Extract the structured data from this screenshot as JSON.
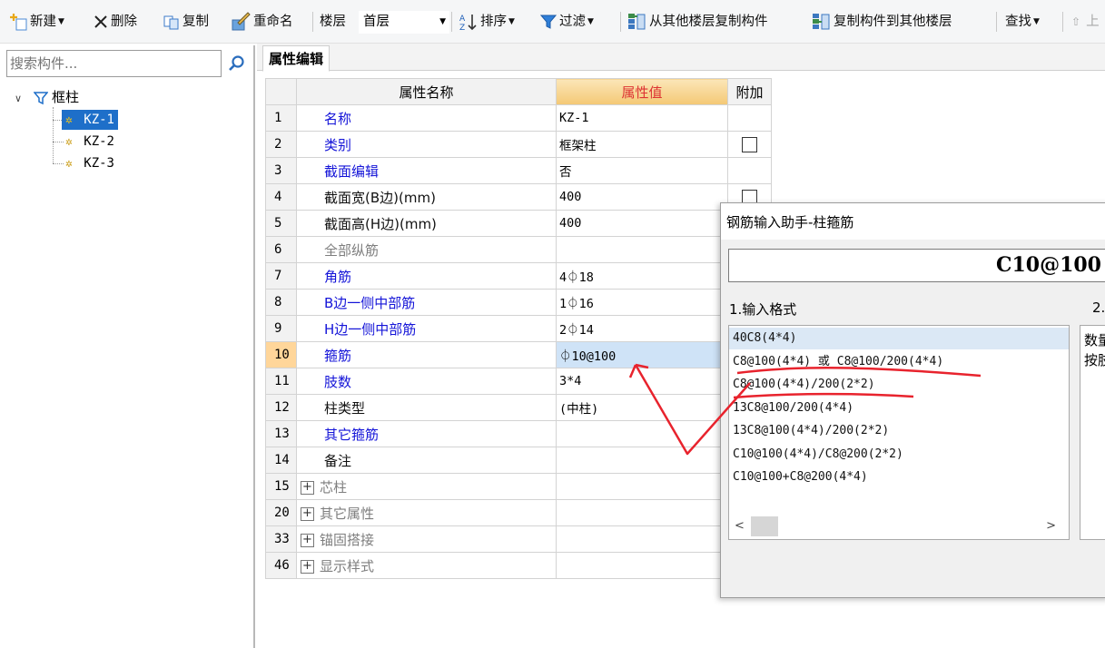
{
  "toolbar": {
    "new": "新建",
    "delete": "删除",
    "copy": "复制",
    "rename": "重命名",
    "floor_label": "楼层",
    "floor_value": "首层",
    "sort": "排序",
    "filter": "过滤",
    "copy_from_floors": "从其他楼层复制构件",
    "copy_to_floors": "复制构件到其他楼层",
    "find": "查找",
    "up": "上"
  },
  "left_panel": {
    "search_placeholder": "搜索构件...",
    "tree": {
      "root": "框柱",
      "items": [
        "KZ-1",
        "KZ-2",
        "KZ-3"
      ],
      "selected": "KZ-1"
    }
  },
  "properties": {
    "tab": "属性编辑",
    "headers": {
      "name": "属性名称",
      "value": "属性值",
      "extra": "附加"
    },
    "rows": [
      {
        "num": "1",
        "name": "名称",
        "value": "KZ-1",
        "style": "blue",
        "checkbox": false
      },
      {
        "num": "2",
        "name": "类别",
        "value": "框架柱",
        "style": "blue",
        "checkbox": true
      },
      {
        "num": "3",
        "name": "截面编辑",
        "value": "否",
        "style": "blue",
        "checkbox": false
      },
      {
        "num": "4",
        "name": "截面宽(B边)(mm)",
        "value": "400",
        "style": "black",
        "checkbox": true
      },
      {
        "num": "5",
        "name": "截面高(H边)(mm)",
        "value": "400",
        "style": "black",
        "checkbox": false
      },
      {
        "num": "6",
        "name": "全部纵筋",
        "value": "",
        "style": "gray",
        "checkbox": false
      },
      {
        "num": "7",
        "name": "角筋",
        "value": "4⏀18",
        "style": "blue",
        "checkbox": false
      },
      {
        "num": "8",
        "name": "B边一侧中部筋",
        "value": "1⏀16",
        "style": "blue",
        "checkbox": false
      },
      {
        "num": "9",
        "name": "H边一侧中部筋",
        "value": "2⏀14",
        "style": "blue",
        "checkbox": false
      },
      {
        "num": "10",
        "name": "箍筋",
        "value": "⏀10@100",
        "style": "blue",
        "checkbox": false,
        "selected": true
      },
      {
        "num": "11",
        "name": "肢数",
        "value": "3*4",
        "style": "blue",
        "checkbox": false
      },
      {
        "num": "12",
        "name": "柱类型",
        "value": "(中柱)",
        "style": "black",
        "checkbox": false
      },
      {
        "num": "13",
        "name": "其它箍筋",
        "value": "",
        "style": "blue",
        "checkbox": false
      },
      {
        "num": "14",
        "name": "备注",
        "value": "",
        "style": "black",
        "checkbox": false
      }
    ],
    "groups": [
      {
        "num": "15",
        "name": "芯柱"
      },
      {
        "num": "20",
        "name": "其它属性"
      },
      {
        "num": "33",
        "name": "锚固搭接"
      },
      {
        "num": "46",
        "name": "显示样式"
      }
    ],
    "group_expander": "+"
  },
  "dialog": {
    "title": "钢筋输入助手-柱箍筋",
    "formula": "C10@100",
    "section1": "1.输入格式",
    "section2": "2.",
    "formats": [
      "40C8(4*4)",
      "C8@100(4*4) 或 C8@100/200(4*4)",
      "C8@100(4*4)/200(2*2)",
      "13C8@100/200(4*4)",
      "13C8@100(4*4)/200(2*2)",
      "C10@100(4*4)/C8@200(2*2)",
      "C10@100+C8@200(4*4)"
    ],
    "selected_format_index": 0,
    "description": [
      "数量",
      "按肢"
    ]
  },
  "colors": {
    "selection_blue": "#1e6fc9",
    "link_blue": "#1414d8",
    "header_gold": "#f4c875",
    "annotation_red": "#e8232d"
  }
}
